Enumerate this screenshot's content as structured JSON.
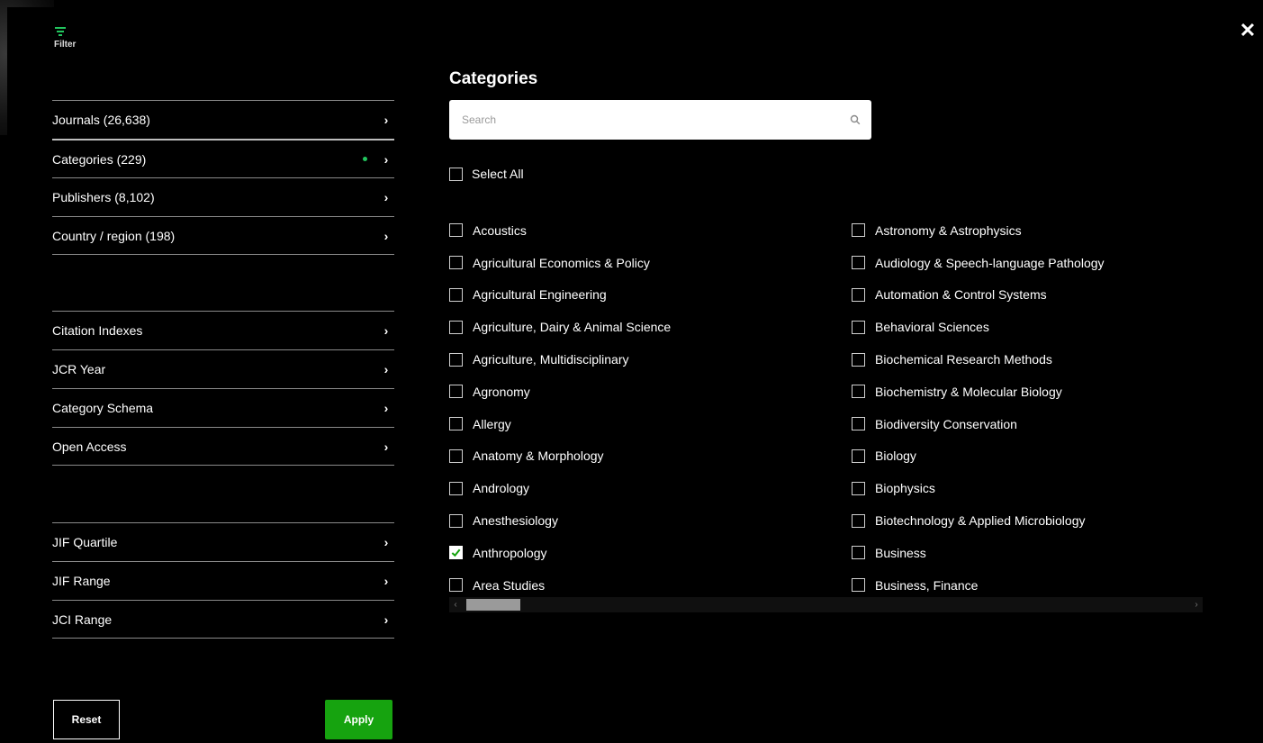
{
  "filter_header": {
    "label": "Filter",
    "icon": "filter-icon",
    "accent": "#22c55e"
  },
  "close": {
    "glyph": "✕"
  },
  "nav_groups": [
    {
      "items": [
        {
          "label": "Journals (26,638)",
          "chevron": "›",
          "active": false,
          "dot": false
        },
        {
          "label": "Categories (229)",
          "chevron": "›",
          "active": true,
          "dot": true
        },
        {
          "label": "Publishers (8,102)",
          "chevron": "›",
          "active": false,
          "dot": false
        },
        {
          "label": "Country / region (198)",
          "chevron": "›",
          "active": false,
          "dot": false
        }
      ]
    },
    {
      "items": [
        {
          "label": "Citation Indexes",
          "chevron": "›"
        },
        {
          "label": "JCR Year",
          "chevron": "›"
        },
        {
          "label": "Category Schema",
          "chevron": "›"
        },
        {
          "label": "Open Access",
          "chevron": "›"
        }
      ]
    },
    {
      "items": [
        {
          "label": "JIF Quartile",
          "chevron": "›"
        },
        {
          "label": "JIF Range",
          "chevron": "›"
        },
        {
          "label": "JCI Range",
          "chevron": "›"
        }
      ]
    }
  ],
  "buttons": {
    "reset": "Reset",
    "apply": "Apply",
    "apply_color": "#16a30f"
  },
  "categories": {
    "title": "Categories",
    "search_placeholder": "Search",
    "select_all": "Select All",
    "columns": [
      [
        {
          "label": "Acoustics",
          "checked": false
        },
        {
          "label": "Agricultural Economics & Policy",
          "checked": false
        },
        {
          "label": "Agricultural Engineering",
          "checked": false
        },
        {
          "label": "Agriculture, Dairy & Animal Science",
          "checked": false
        },
        {
          "label": "Agriculture, Multidisciplinary",
          "checked": false
        },
        {
          "label": "Agronomy",
          "checked": false
        },
        {
          "label": "Allergy",
          "checked": false
        },
        {
          "label": "Anatomy & Morphology",
          "checked": false
        },
        {
          "label": "Andrology",
          "checked": false
        },
        {
          "label": "Anesthesiology",
          "checked": false
        },
        {
          "label": "Anthropology",
          "checked": true
        },
        {
          "label": "Area Studies",
          "checked": false
        }
      ],
      [
        {
          "label": "Astronomy & Astrophysics",
          "checked": false
        },
        {
          "label": "Audiology & Speech-language Pathology",
          "checked": false
        },
        {
          "label": "Automation & Control Systems",
          "checked": false
        },
        {
          "label": "Behavioral Sciences",
          "checked": false
        },
        {
          "label": "Biochemical Research Methods",
          "checked": false
        },
        {
          "label": "Biochemistry & Molecular Biology",
          "checked": false
        },
        {
          "label": "Biodiversity Conservation",
          "checked": false
        },
        {
          "label": "Biology",
          "checked": false
        },
        {
          "label": "Biophysics",
          "checked": false
        },
        {
          "label": "Biotechnology & Applied Microbiology",
          "checked": false
        },
        {
          "label": "Business",
          "checked": false
        },
        {
          "label": "Business, Finance",
          "checked": false
        }
      ]
    ]
  },
  "scrollbar": {
    "left_arrow": "‹",
    "right_arrow": "›"
  }
}
